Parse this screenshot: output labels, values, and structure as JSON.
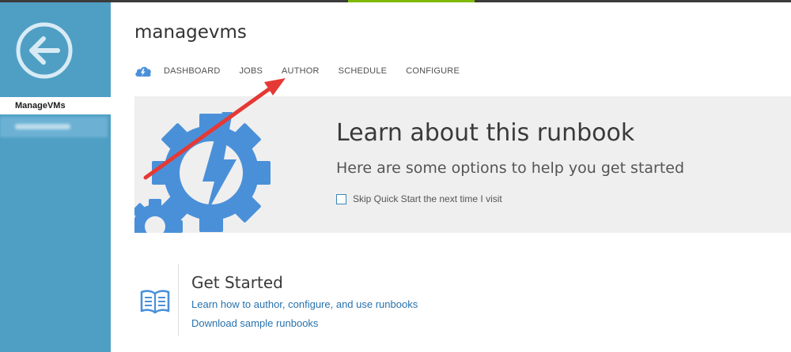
{
  "sidebar": {
    "active_item": "ManageVMs",
    "colors": {
      "background": "#4f9fc4",
      "active_bg": "#ffffff"
    },
    "icons": {
      "back": "back-arrow-circle-icon"
    }
  },
  "header": {
    "title": "managevms"
  },
  "tabs": [
    {
      "label": "DASHBOARD"
    },
    {
      "label": "JOBS"
    },
    {
      "label": "AUTHOR"
    },
    {
      "label": "SCHEDULE"
    },
    {
      "label": "CONFIGURE"
    }
  ],
  "hero": {
    "title": "Learn about this runbook",
    "subtitle": "Here are some options to help you get started",
    "skip_label": "Skip Quick Start the next time I visit",
    "skip_checked": false
  },
  "get_started": {
    "title": "Get Started",
    "links": [
      "Learn how to author, configure, and use runbooks",
      "Download sample runbooks"
    ]
  },
  "colors": {
    "accent_blue": "#4a90d9",
    "link": "#2872ad",
    "annotation_arrow": "#e53935",
    "top_accent": "#7fba00"
  }
}
